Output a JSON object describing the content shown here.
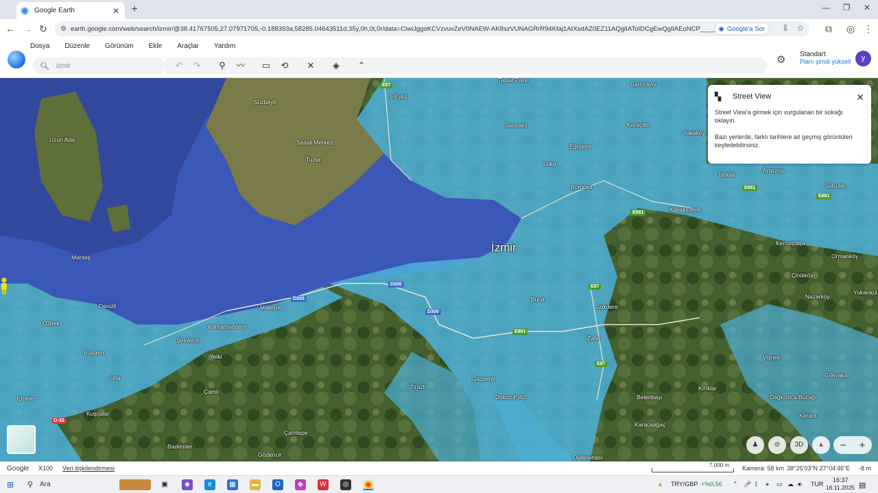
{
  "browser": {
    "tab_title": "Google Earth",
    "url": "earth.google.com/web/search/izmir/@38.41767505,27.07971705,-0.188393a,58285.04643511d,35y,0h,0t,0r/data=CiwiJggoKCVzvuvZeV0NAEW-AK8szVUNAGRrR94Kfaj1AIXsdAZ0EZ11AQglIAToIDCgEwQgIlAEoNCP________wEQAA",
    "google_search_chip": "Google'a Sor"
  },
  "menu": [
    "Dosya",
    "Düzenle",
    "Görünüm",
    "Ekle",
    "Araçlar",
    "Yardım"
  ],
  "search": {
    "value": "izmir"
  },
  "account": {
    "plan_title": "Standart",
    "plan_link": "Planı şimdi yükselt",
    "avatar_letter": "y"
  },
  "street_view": {
    "title": "Street View",
    "line1": "Street View'a girmek için vurgulanan bir sokağı tıklayın.",
    "line2": "Bazı yerlerde, farklı tarihlere ait geçmiş görüntüleri keşfedebilirsiniz."
  },
  "map_labels": {
    "izmir": "İzmir",
    "suzbeyli": "Süzbeyli",
    "uzun_ada": "Uzun Ada",
    "sasali": "Sasali Merkez",
    "tuzla": "Tuzla",
    "eylul9": "9 Eylül",
    "tabiat_parki": "Tabiat Parkı",
    "sarnickoy": "Sarnıçköy",
    "sancakli": "Sancaklı",
    "egridere": "Eğridere",
    "karacam": "Karaçam",
    "yakakoy": "Yakaköy",
    "laka": "Laka",
    "bornova": "Bornova",
    "istiklal": "İstiklal",
    "ansizca": "Ansızca",
    "sulcular": "Sulçular",
    "kavaklidere": "Kavaklıdere",
    "kemalpasa": "Kemalpaşa",
    "ormankoy": "Ormanköy",
    "ciniliikoy": "Çiniliköy",
    "nazarkoy": "Nazarköy",
    "yukarikizilca": "Yukarıkızılca",
    "mentes": "Menteş",
    "denizli": "Denizli",
    "ozbek": "Özbek",
    "rustem": "Rüstem",
    "urla": "Urla",
    "icmeler": "İçmeler",
    "kuscular": "Kuşçular",
    "sirinkent": "Şirinkent",
    "kahramandere": "Kahramandere",
    "maltepe": "Maltepe",
    "yelki": "Yelki",
    "camli": "Çamlı",
    "camtepe": "Çamtepe",
    "bademler": "Bademler",
    "godence": "Gödence",
    "buca": "Buca",
    "gokdere": "Gökdere",
    "zafer": "Zafer",
    "gaziemir": "Gaziemir",
    "tirazli": "Tirazlı",
    "dokuz_eylul": "Dokuz Eylül",
    "belenbasi": "Belenbaşı",
    "kirikler": "Kırıklar",
    "karacaagac": "Karacaağaç",
    "dagkizilca": "Dağkızılca Bucağı",
    "karaot": "Karaot",
    "visneli": "Vişneli",
    "gokyaka": "Gökyaka",
    "oglananasi": "Oğlananası"
  },
  "road_shields": {
    "e87": "E87",
    "e881": "E881",
    "d300": "D300",
    "o32": "O-32"
  },
  "map_controls": {
    "three_d": "3D"
  },
  "footer": {
    "google": "Google",
    "zoom": "X100",
    "data_link": "Veri ilişkilendirmesi",
    "scale": "7.000 m",
    "camera": "Kamera: 58 km",
    "coords": "38°25'03\"N 27°04'46\"E",
    "elev": "-8 m"
  },
  "taskbar": {
    "search": "Ara",
    "currency": "TRY/GBP",
    "currency_change": "+%0,56",
    "lang": "TUR",
    "time": "16:37",
    "date": "16.11.2025"
  }
}
